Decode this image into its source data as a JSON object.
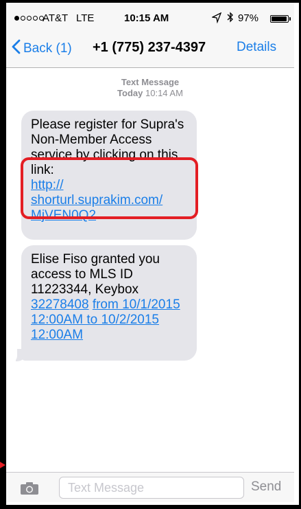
{
  "status_bar": {
    "carrier": "AT&T",
    "network": "LTE",
    "time": "10:15 AM",
    "battery": "97%",
    "battery_level": 0.97,
    "signal_bars_filled": 1,
    "icons": [
      "signal-dots-icon",
      "location-arrow-icon",
      "bluetooth-icon",
      "battery-icon"
    ]
  },
  "nav": {
    "back_label": "Back (1)",
    "title": "+1 (775) 237-4397",
    "details_label": "Details"
  },
  "conversation": {
    "meta_header": "Text Message",
    "meta_day": "Today",
    "meta_time": "10:14 AM",
    "messages": [
      {
        "text": "Please register for Supra's Non-Member Access service by clicking on this link:",
        "link": "http://shorturl.suprakim.com/MjVEN0Q2",
        "link_line1": "http://",
        "link_line2": "shorturl.suprakim.com/",
        "link_line3": "MjVEN0Q2"
      },
      {
        "text_part1": "Elise Fiso granted you access to MLS ID 11223344, Keybox",
        "keybox_link": "32278408",
        "range_link": "from 10/1/2015 12:00AM to 10/2/2015 12:00AM"
      }
    ]
  },
  "input_bar": {
    "placeholder": "Text Message",
    "value": "",
    "send_label": "Send"
  },
  "colors": {
    "accent": "#1a7ee8",
    "bubble": "#e5e5ea",
    "highlight": "#e31e24"
  }
}
